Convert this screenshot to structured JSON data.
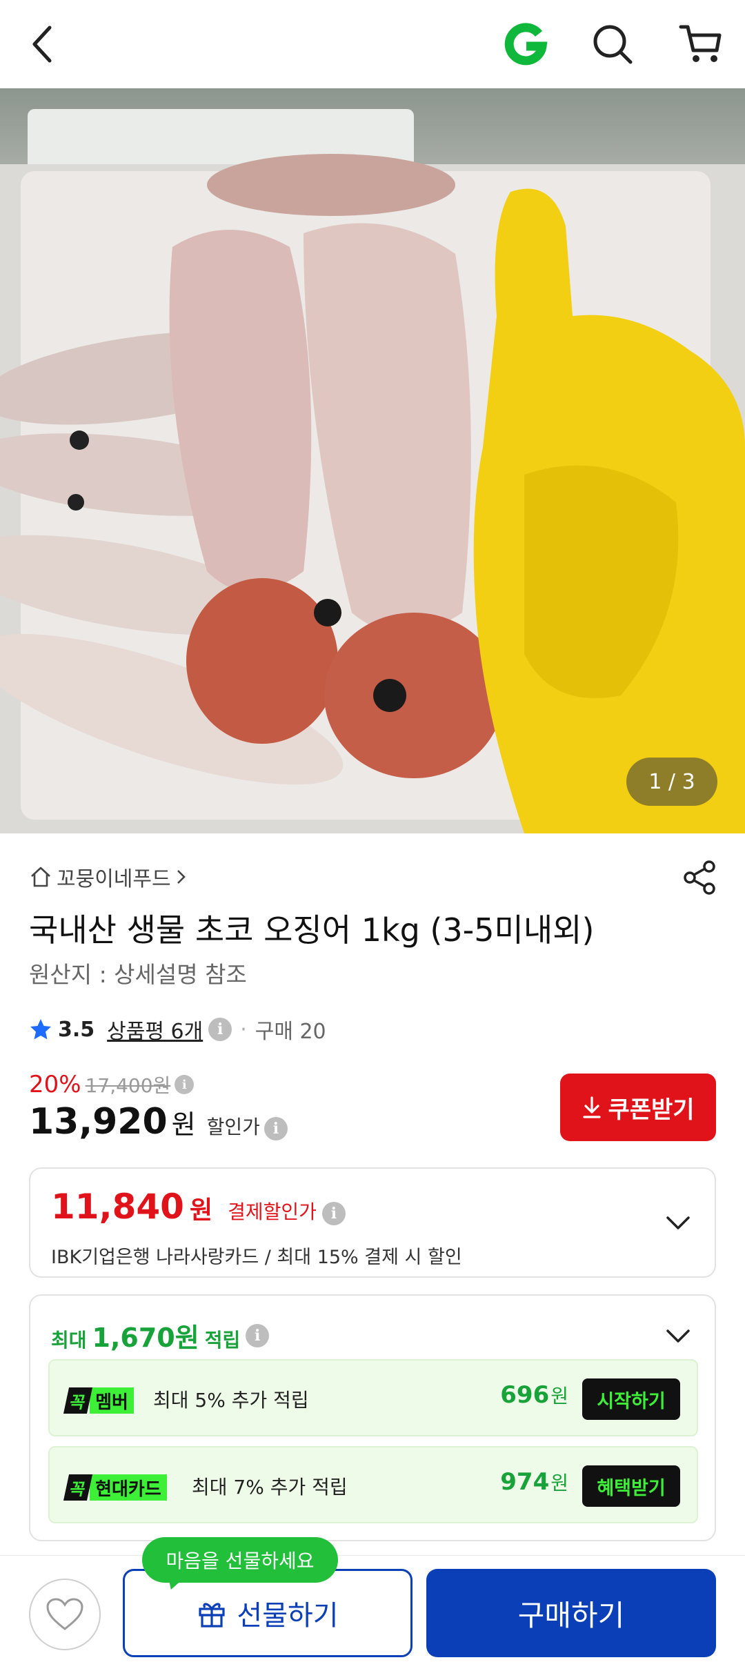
{
  "header": {
    "back_icon": "chevron-left-icon",
    "logo_icon": "gmarket-g-logo",
    "search_icon": "search-icon",
    "cart_icon": "cart-icon",
    "logo_color": "#0fb83a"
  },
  "hero": {
    "image_counter": "1 / 3"
  },
  "product": {
    "seller": "꼬뭉이네푸드",
    "title": "국내산 생물 초코 오징어 1kg (3-5미내외)",
    "origin": "원산지 : 상세설명 참조",
    "rating": "3.5",
    "reviews": "상품평 6개",
    "purchases": "구매 20",
    "discount_percent": "20%",
    "original_price": "17,400원",
    "price": "13,920",
    "price_unit": "원",
    "price_label": "할인가",
    "coupon_label": "쿠폰받기"
  },
  "payment_discount": {
    "amount": "11,840",
    "unit": "원",
    "label": "결제할인가",
    "description": "IBK기업은행 나라사랑카드 / 최대 15% 결제 시 할인"
  },
  "points": {
    "prefix": "최대",
    "amount": "1,670원",
    "suffix": "적립",
    "benefits": [
      {
        "badge_k": "꼭",
        "badge_text": "멤버",
        "text": "최대 5% 추가 적립",
        "points": "696",
        "unit": "원",
        "action": "시작하기"
      },
      {
        "badge_k": "꼭",
        "badge_text": "현대카드",
        "text": "최대 7% 추가 적립",
        "points": "974",
        "unit": "원",
        "action": "혜택받기"
      }
    ]
  },
  "bottom": {
    "tooltip": "마음을 선물하세요",
    "gift_label": "선물하기",
    "buy_label": "구매하기"
  },
  "colors": {
    "accent_red": "#e0131a",
    "accent_green": "#18a23a",
    "primary_blue": "#0b3fb8"
  }
}
